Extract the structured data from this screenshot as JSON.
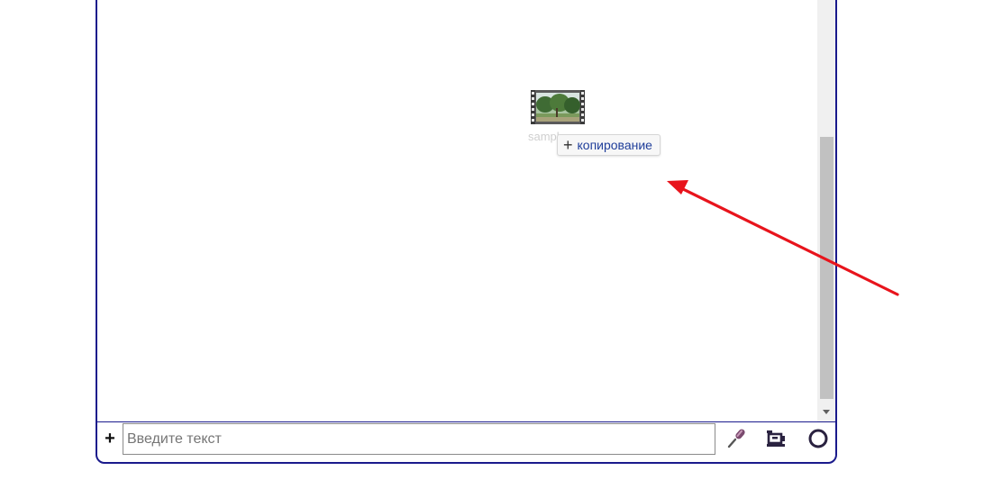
{
  "file": {
    "name": "sampl...",
    "icon": "video-file-icon"
  },
  "drag_tooltip": {
    "action": "копирование"
  },
  "input": {
    "placeholder": "Введите текст",
    "value": ""
  },
  "toolbar": {
    "plus_label": "+",
    "mic_icon": "microphone-icon",
    "screen_icon": "screen-record-icon",
    "circle_icon": "record-circle-icon"
  },
  "annotation": {
    "arrow_color": "#e8141c"
  },
  "colors": {
    "frame_border": "#1a1a8c",
    "tooltip_text": "#1f3e9a"
  }
}
